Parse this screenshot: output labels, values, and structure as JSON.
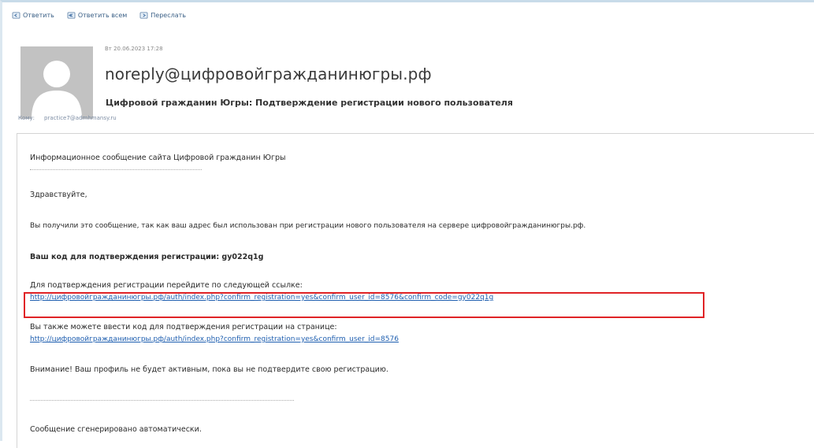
{
  "toolbar": {
    "reply_label": "Ответить",
    "reply_all_label": "Ответить всем",
    "forward_label": "Переслать"
  },
  "header": {
    "datetime": "Вт 20.06.2023 17:28",
    "sender": "noreply@цифровойгражданинюгры.рф",
    "subject": "Цифровой гражданин Югры: Подтверждение регистрации нового пользователя",
    "to_label": "Кому:",
    "to_value": "practice7@admhmansy.ru"
  },
  "body": {
    "intro": "Информационное сообщение сайта Цифровой гражданин Югры",
    "greeting": "Здравствуйте,",
    "reason": "Вы получили это сообщение, так как ваш адрес был использован при регистрации нового пользователя на сервере цифровойгражданинюгры.рф.",
    "code_line": "Ваш код для подтверждения регистрации: gy022q1g",
    "confirm_label": "Для подтверждения регистрации перейдите по следующей ссылке:",
    "confirm_link": "http://цифровойгражданинюгры.рф/auth/index.php?confirm_registration=yes&confirm_user_id=8576&confirm_code=gy022q1g",
    "alt_label": "Вы также можете ввести код для подтверждения регистрации на странице:",
    "alt_link": "http://цифровойгражданинюгры.рф/auth/index.php?confirm_registration=yes&confirm_user_id=8576",
    "warning": "Внимание! Ваш профиль не будет активным, пока вы не подтвердите свою регистрацию.",
    "auto_note": "Сообщение сгенерировано автоматически."
  },
  "colors": {
    "link": "#1f5fb0",
    "highlight_border": "#e02326",
    "avatar_bg": "#c2c2c2"
  }
}
